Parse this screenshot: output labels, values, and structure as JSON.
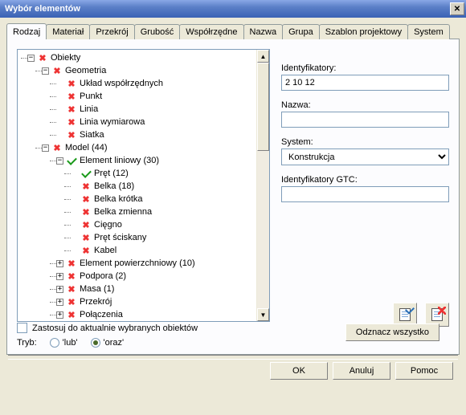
{
  "title": "Wybór elementów",
  "tabs": [
    "Rodzaj",
    "Materiał",
    "Przekrój",
    "Grubość",
    "Współrzędne",
    "Nazwa",
    "Grupa",
    "Szablon projektowy",
    "System"
  ],
  "active_tab": "Rodzaj",
  "tree": [
    {
      "d": 0,
      "exp": "-",
      "mark": "x",
      "label": "Obiekty"
    },
    {
      "d": 1,
      "exp": "-",
      "mark": "x",
      "label": "Geometria"
    },
    {
      "d": 2,
      "exp": "",
      "mark": "x",
      "label": "Układ współrzędnych"
    },
    {
      "d": 2,
      "exp": "",
      "mark": "x",
      "label": "Punkt"
    },
    {
      "d": 2,
      "exp": "",
      "mark": "x",
      "label": "Linia"
    },
    {
      "d": 2,
      "exp": "",
      "mark": "x",
      "label": "Linia wymiarowa"
    },
    {
      "d": 2,
      "exp": "",
      "mark": "x",
      "label": "Siatka"
    },
    {
      "d": 1,
      "exp": "-",
      "mark": "x",
      "label": "Model (44)"
    },
    {
      "d": 2,
      "exp": "-",
      "mark": "chk",
      "label": "Element liniowy (30)"
    },
    {
      "d": 3,
      "exp": "",
      "mark": "chk",
      "label": "Pręt (12)"
    },
    {
      "d": 3,
      "exp": "",
      "mark": "x",
      "label": "Belka (18)"
    },
    {
      "d": 3,
      "exp": "",
      "mark": "x",
      "label": "Belka krótka"
    },
    {
      "d": 3,
      "exp": "",
      "mark": "x",
      "label": "Belka zmienna"
    },
    {
      "d": 3,
      "exp": "",
      "mark": "x",
      "label": "Cięgno"
    },
    {
      "d": 3,
      "exp": "",
      "mark": "x",
      "label": "Pręt ściskany"
    },
    {
      "d": 3,
      "exp": "",
      "mark": "x",
      "label": "Kabel"
    },
    {
      "d": 2,
      "exp": "+",
      "mark": "x",
      "label": "Element powierzchniowy (10)"
    },
    {
      "d": 2,
      "exp": "+",
      "mark": "x",
      "label": "Podpora (2)"
    },
    {
      "d": 2,
      "exp": "+",
      "mark": "x",
      "label": "Masa (1)"
    },
    {
      "d": 2,
      "exp": "+",
      "mark": "x",
      "label": "Przekrój"
    },
    {
      "d": 2,
      "exp": "+",
      "mark": "x",
      "label": "Połączenia"
    }
  ],
  "right": {
    "id_label": "Identyfikatory:",
    "id_value": "2 10 12",
    "name_label": "Nazwa:",
    "name_value": "",
    "system_label": "System:",
    "system_value": "Konstrukcja",
    "gtc_label": "Identyfikatory GTC:",
    "gtc_value": ""
  },
  "footer": {
    "apply_label": "Zastosuj do aktualnie wybranych obiektów",
    "mode_label": "Tryb:",
    "mode_or": "'lub'",
    "mode_and": "'oraz'",
    "deselect": "Odznacz wszystko"
  },
  "buttons": {
    "ok": "OK",
    "cancel": "Anuluj",
    "help": "Pomoc"
  }
}
